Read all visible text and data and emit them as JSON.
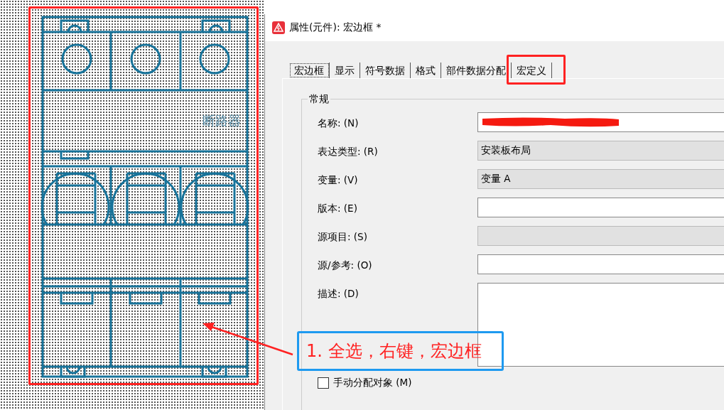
{
  "canvas": {
    "symbol_label": "断路器"
  },
  "window": {
    "title": "属性(元件): 宏边框 *"
  },
  "tabs": [
    {
      "label": "宏边框",
      "selected": true
    },
    {
      "label": "显示",
      "selected": false
    },
    {
      "label": "符号数据",
      "selected": false
    },
    {
      "label": "格式",
      "selected": false
    },
    {
      "label": "部件数据分配",
      "selected": false
    },
    {
      "label": "宏定义",
      "selected": false
    }
  ],
  "group": {
    "title": "常规"
  },
  "fields": [
    {
      "label": "名称: (N)",
      "kind": "redacted"
    },
    {
      "label": "表达类型: (R)",
      "kind": "readonly",
      "value": "安装板布局"
    },
    {
      "label": "变量: (V)",
      "kind": "readonly",
      "value": "变量 A"
    },
    {
      "label": "版本: (E)",
      "kind": "text"
    },
    {
      "label": "源项目: (S)",
      "kind": "readonly"
    },
    {
      "label": "源/参考: (O)",
      "kind": "text"
    },
    {
      "label": "描述: (D)",
      "kind": "multiline"
    }
  ],
  "checkbox": {
    "label": "手动分配对象 (M)",
    "checked": false
  },
  "annotation": {
    "text": "1. 全选，右键，宏边框"
  }
}
